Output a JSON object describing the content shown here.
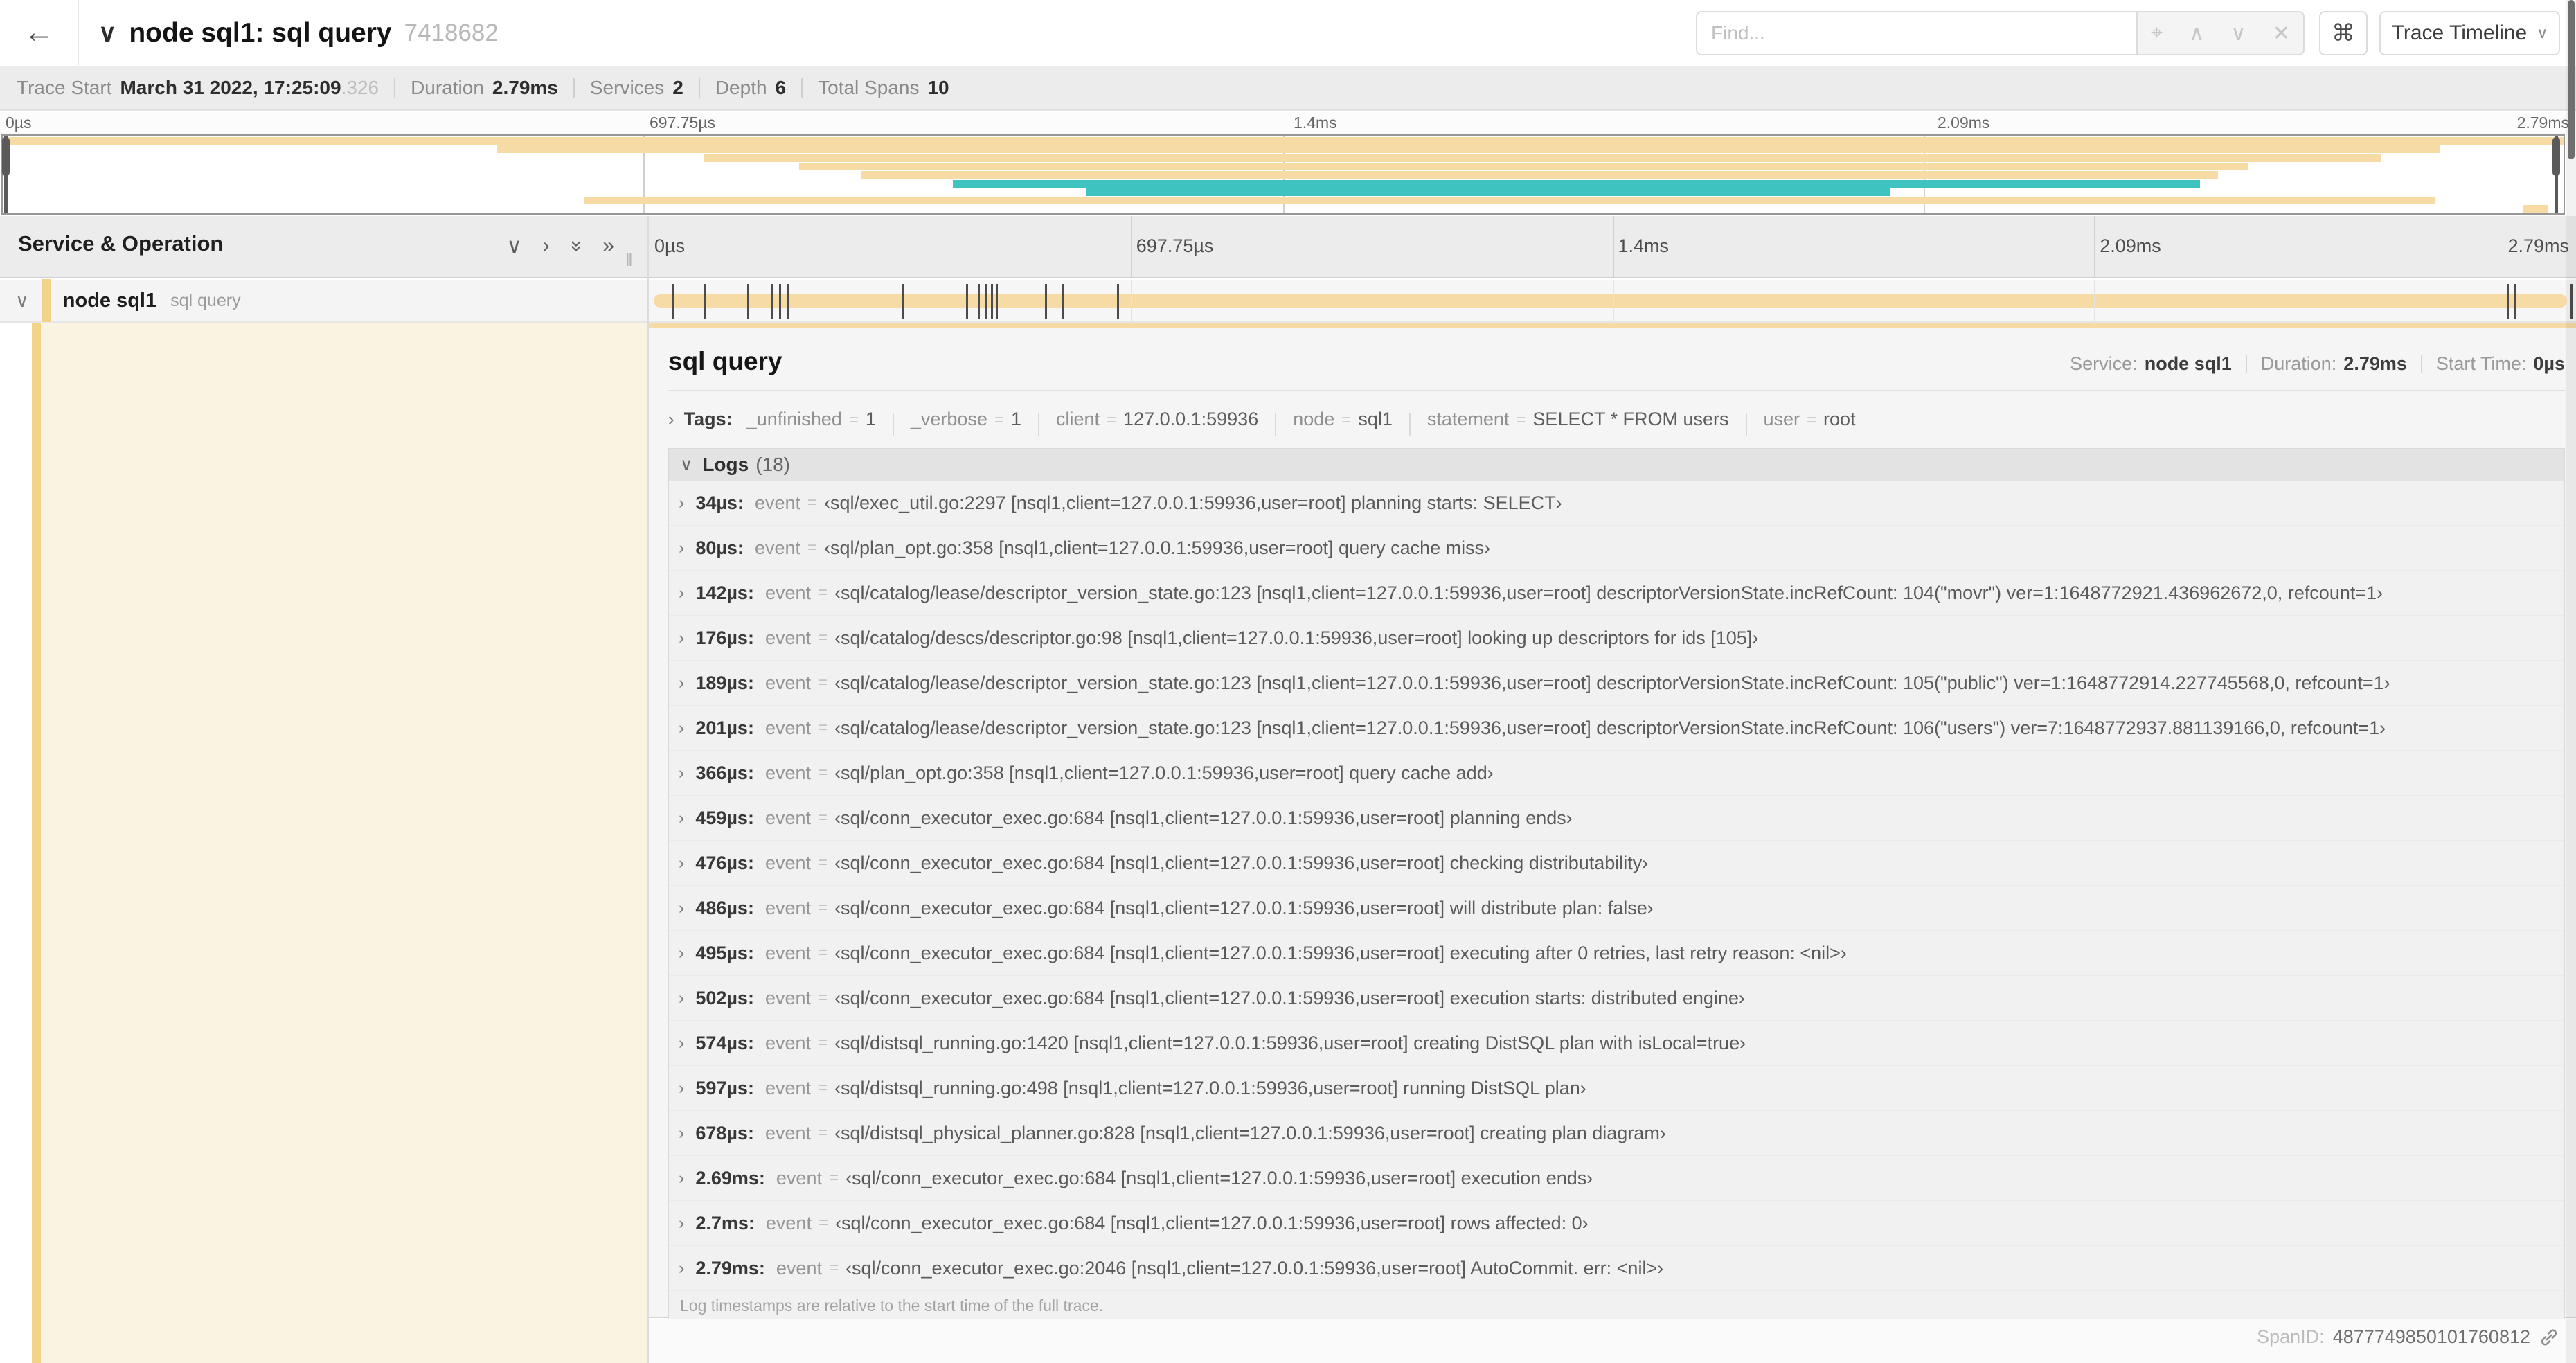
{
  "header": {
    "back_icon": "←",
    "collapse_icon": "∨",
    "title": "node sql1: sql query",
    "trace_id": "7418682",
    "find_placeholder": "Find...",
    "find_icons": [
      "⌖",
      "∧",
      "∨",
      "✕"
    ],
    "shortcut_button": "⌘",
    "view_button": "Trace Timeline",
    "view_button_chevron": "∨"
  },
  "stats": {
    "items": [
      {
        "label": "Trace Start",
        "value": "March 31 2022, 17:25:09",
        "suffix": ".326"
      },
      {
        "label": "Duration",
        "value": "2.79ms"
      },
      {
        "label": "Services",
        "value": "2"
      },
      {
        "label": "Depth",
        "value": "6"
      },
      {
        "label": "Total Spans",
        "value": "10"
      }
    ]
  },
  "timeline": {
    "ticks": [
      {
        "label": "0µs",
        "pct": 0
      },
      {
        "label": "697.75µs",
        "pct": 25
      },
      {
        "label": "1.4ms",
        "pct": 50
      },
      {
        "label": "2.09ms",
        "pct": 75
      },
      {
        "label": "2.79ms",
        "pct": 100
      }
    ]
  },
  "minimap": {
    "colors": {
      "tan": "#f6dba4",
      "teal": "#3ec3c0"
    },
    "rows": [
      {
        "start": 0,
        "end": 100,
        "color": "tan"
      },
      {
        "start": 19.3,
        "end": 95.2,
        "color": "tan"
      },
      {
        "start": 27.4,
        "end": 92.9,
        "color": "tan"
      },
      {
        "start": 31.1,
        "end": 87.7,
        "color": "tan"
      },
      {
        "start": 33.5,
        "end": 86.5,
        "color": "tan"
      },
      {
        "start": 37.1,
        "end": 85.8,
        "color": "teal"
      },
      {
        "start": 42.3,
        "end": 73.7,
        "color": "teal"
      },
      {
        "start": 22.7,
        "end": 95.0,
        "color": "tan"
      },
      {
        "start": 98.4,
        "end": 99.4,
        "color": "tan"
      }
    ]
  },
  "tree": {
    "header": "Service & Operation",
    "header_icons": [
      "∨",
      "›",
      "»",
      "»"
    ],
    "span_service": "node sql1",
    "span_operation": "sql query"
  },
  "detail": {
    "title": "sql query",
    "meta": [
      {
        "label": "Service:",
        "value": "node sql1"
      },
      {
        "label": "Duration:",
        "value": "2.79ms"
      },
      {
        "label": "Start Time:",
        "value": "0µs"
      }
    ],
    "tags_label": "Tags:",
    "tags": [
      {
        "key": "_unfinished",
        "value": "1"
      },
      {
        "key": "_verbose",
        "value": "1"
      },
      {
        "key": "client",
        "value": "127.0.0.1:59936"
      },
      {
        "key": "node",
        "value": "sql1"
      },
      {
        "key": "statement",
        "value": "SELECT * FROM users"
      },
      {
        "key": "user",
        "value": "root"
      }
    ],
    "event_label": "event",
    "eq_sign": "=",
    "logs_label": "Logs",
    "logs_count": "(18)",
    "logs": [
      {
        "time": "34µs:",
        "pct": 1.22,
        "value": "‹sql/exec_util.go:2297 [nsql1,client=127.0.0.1:59936,user=root] planning starts: SELECT›"
      },
      {
        "time": "80µs:",
        "pct": 2.87,
        "value": "‹sql/plan_opt.go:358 [nsql1,client=127.0.0.1:59936,user=root] query cache miss›"
      },
      {
        "time": "142µs:",
        "pct": 5.09,
        "value": "‹sql/catalog/lease/descriptor_version_state.go:123 [nsql1,client=127.0.0.1:59936,user=root] descriptorVersionState.incRefCount: 104(\"movr\") ver=1:1648772921.436962672,0, refcount=1›"
      },
      {
        "time": "176µs:",
        "pct": 6.31,
        "value": "‹sql/catalog/descs/descriptor.go:98 [nsql1,client=127.0.0.1:59936,user=root] looking up descriptors for ids [105]›"
      },
      {
        "time": "189µs:",
        "pct": 6.77,
        "value": "‹sql/catalog/lease/descriptor_version_state.go:123 [nsql1,client=127.0.0.1:59936,user=root] descriptorVersionState.incRefCount: 105(\"public\") ver=1:1648772914.227745568,0, refcount=1›"
      },
      {
        "time": "201µs:",
        "pct": 7.2,
        "value": "‹sql/catalog/lease/descriptor_version_state.go:123 [nsql1,client=127.0.0.1:59936,user=root] descriptorVersionState.incRefCount: 106(\"users\") ver=7:1648772937.881139166,0, refcount=1›"
      },
      {
        "time": "366µs:",
        "pct": 13.12,
        "value": "‹sql/plan_opt.go:358 [nsql1,client=127.0.0.1:59936,user=root] query cache add›"
      },
      {
        "time": "459µs:",
        "pct": 16.45,
        "value": "‹sql/conn_executor_exec.go:684 [nsql1,client=127.0.0.1:59936,user=root] planning ends›"
      },
      {
        "time": "476µs:",
        "pct": 17.06,
        "value": "‹sql/conn_executor_exec.go:684 [nsql1,client=127.0.0.1:59936,user=root] checking distributability›"
      },
      {
        "time": "486µs:",
        "pct": 17.42,
        "value": "‹sql/conn_executor_exec.go:684 [nsql1,client=127.0.0.1:59936,user=root] will distribute plan: false›"
      },
      {
        "time": "495µs:",
        "pct": 17.74,
        "value": "‹sql/conn_executor_exec.go:684 [nsql1,client=127.0.0.1:59936,user=root] executing after 0 retries, last retry reason: <nil>›"
      },
      {
        "time": "502µs:",
        "pct": 18.0,
        "value": "‹sql/conn_executor_exec.go:684 [nsql1,client=127.0.0.1:59936,user=root] execution starts: distributed engine›"
      },
      {
        "time": "574µs:",
        "pct": 20.57,
        "value": "‹sql/distsql_running.go:1420 [nsql1,client=127.0.0.1:59936,user=root] creating DistSQL plan with isLocal=true›"
      },
      {
        "time": "597µs:",
        "pct": 21.4,
        "value": "‹sql/distsql_running.go:498 [nsql1,client=127.0.0.1:59936,user=root] running DistSQL plan›"
      },
      {
        "time": "678µs:",
        "pct": 24.3,
        "value": "‹sql/distsql_physical_planner.go:828 [nsql1,client=127.0.0.1:59936,user=root] creating plan diagram›"
      },
      {
        "time": "2.69ms:",
        "pct": 96.42,
        "value": "‹sql/conn_executor_exec.go:684 [nsql1,client=127.0.0.1:59936,user=root] execution ends›"
      },
      {
        "time": "2.7ms:",
        "pct": 96.77,
        "value": "‹sql/conn_executor_exec.go:684 [nsql1,client=127.0.0.1:59936,user=root] rows affected: 0›"
      },
      {
        "time": "2.79ms:",
        "pct": 99.7,
        "value": "‹sql/conn_executor_exec.go:2046 [nsql1,client=127.0.0.1:59936,user=root] AutoCommit. err: <nil>›"
      }
    ],
    "footer_note": "Log timestamps are relative to the start time of the full trace.",
    "spanid_label": "SpanID:",
    "spanid_value": "4877749850101760812"
  }
}
